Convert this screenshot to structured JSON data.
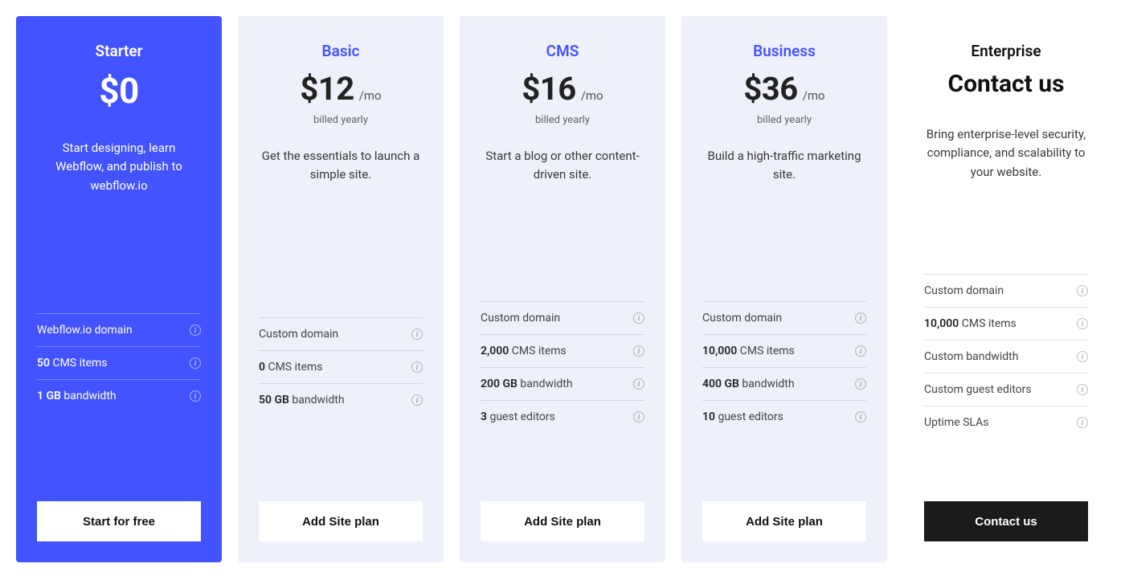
{
  "plans": [
    {
      "name": "Starter",
      "price": "$0",
      "permo": "",
      "billing": "",
      "desc": "Start designing, learn Webflow, and publish to webflow.io",
      "features": [
        {
          "bold": "",
          "text": "Webflow.io domain",
          "info": true
        },
        {
          "bold": "50",
          "text": " CMS items",
          "info": true
        },
        {
          "bold": "1 GB",
          "text": " bandwidth",
          "info": true
        }
      ],
      "cta": "Start for free"
    },
    {
      "name": "Basic",
      "price": "$12",
      "permo": "/mo",
      "billing": "billed yearly",
      "desc": "Get the essentials to launch a simple site.",
      "features": [
        {
          "bold": "",
          "text": "Custom domain",
          "info": true
        },
        {
          "bold": "0",
          "text": " CMS items",
          "info": true
        },
        {
          "bold": "50 GB",
          "text": " bandwidth",
          "info": true
        }
      ],
      "cta": "Add Site plan"
    },
    {
      "name": "CMS",
      "price": "$16",
      "permo": "/mo",
      "billing": "billed yearly",
      "desc": "Start a blog or other content-driven site.",
      "features": [
        {
          "bold": "",
          "text": "Custom domain",
          "info": true
        },
        {
          "bold": "2,000",
          "text": " CMS items",
          "info": true
        },
        {
          "bold": "200 GB",
          "text": " bandwidth",
          "info": true
        },
        {
          "bold": "3",
          "text": " guest editors",
          "info": true
        }
      ],
      "cta": "Add Site plan"
    },
    {
      "name": "Business",
      "price": "$36",
      "permo": "/mo",
      "billing": "billed yearly",
      "desc": "Build a high-traffic marketing site.",
      "features": [
        {
          "bold": "",
          "text": "Custom domain",
          "info": true
        },
        {
          "bold": "10,000",
          "text": " CMS items",
          "info": true
        },
        {
          "bold": "400 GB",
          "text": " bandwidth",
          "info": true
        },
        {
          "bold": "10",
          "text": " guest editors",
          "info": true
        }
      ],
      "cta": "Add Site plan"
    },
    {
      "name": "Enterprise",
      "price": "",
      "contact": "Contact us",
      "permo": "",
      "billing": "",
      "desc": "Bring enterprise-level security, compliance, and scalability to your website.",
      "features": [
        {
          "bold": "",
          "text": "Custom domain",
          "info": true
        },
        {
          "bold": "10,000",
          "text": " CMS items",
          "info": true
        },
        {
          "bold": "",
          "text": "Custom bandwidth",
          "info": true
        },
        {
          "bold": "",
          "text": "Custom guest editors",
          "info": true
        },
        {
          "bold": "",
          "text": "Uptime SLAs",
          "info": true
        }
      ],
      "cta": "Contact us"
    }
  ]
}
